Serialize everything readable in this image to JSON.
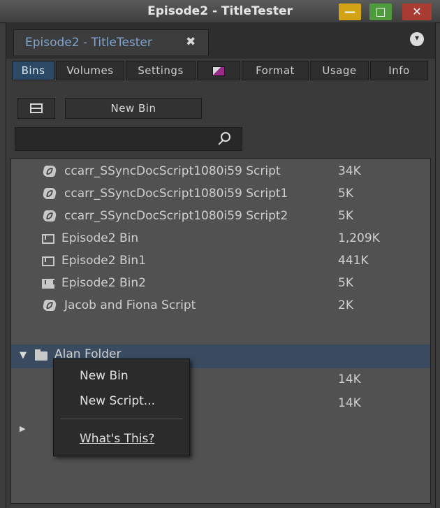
{
  "window": {
    "title": "Episode2 - TitleTester",
    "controls": {
      "minimize": "—",
      "maximize": "□",
      "close": "✕"
    }
  },
  "document_tab": {
    "label": "Episode2 - TitleTester",
    "close": "✖",
    "menu_glyph": "▾"
  },
  "tabs": [
    {
      "label": "Bins",
      "active": true
    },
    {
      "label": "Volumes"
    },
    {
      "label": "Settings"
    },
    {
      "icon": "color-swatch-icon"
    },
    {
      "label": "Format"
    },
    {
      "label": "Usage"
    },
    {
      "label": "Info"
    }
  ],
  "toolbar": {
    "new_bin_label": "New Bin"
  },
  "search": {
    "value": "",
    "placeholder": ""
  },
  "items": [
    {
      "name": "ccarr_SSyncDocScript1080i59 Script",
      "size": "34K",
      "icon": "script-icon"
    },
    {
      "name": "ccarr_SSyncDocScript1080i59 Script1",
      "size": "5K",
      "icon": "script-icon"
    },
    {
      "name": "ccarr_SSyncDocScript1080i59 Script2",
      "size": "5K",
      "icon": "script-icon"
    },
    {
      "name": "Episode2 Bin",
      "size": "1,209K",
      "icon": "bin-icon"
    },
    {
      "name": "Episode2 Bin1",
      "size": "441K",
      "icon": "bin-icon"
    },
    {
      "name": "Episode2 Bin2",
      "size": "5K",
      "icon": "bin-filled-icon"
    },
    {
      "name": "Jacob and Fiona Script",
      "size": "2K",
      "icon": "script-icon"
    },
    {
      "name": "Alan Folder",
      "size": "",
      "icon": "folder-icon",
      "expanded": true,
      "selected": true
    },
    {
      "name": "",
      "size": "14K"
    },
    {
      "name": "",
      "size": "14K"
    }
  ],
  "context_menu": {
    "items": [
      {
        "label": "New Bin"
      },
      {
        "label": "New Script..."
      },
      {
        "label": "What's This?",
        "underlined": true
      }
    ]
  },
  "colors": {
    "selection": "#3a4b60",
    "active_tab": "#2c4a66",
    "doc_tab_text": "#7fa5cf",
    "minimize_button": "#d3a316",
    "maximize_button": "#4f9a3c",
    "close_button": "#a83b32"
  }
}
